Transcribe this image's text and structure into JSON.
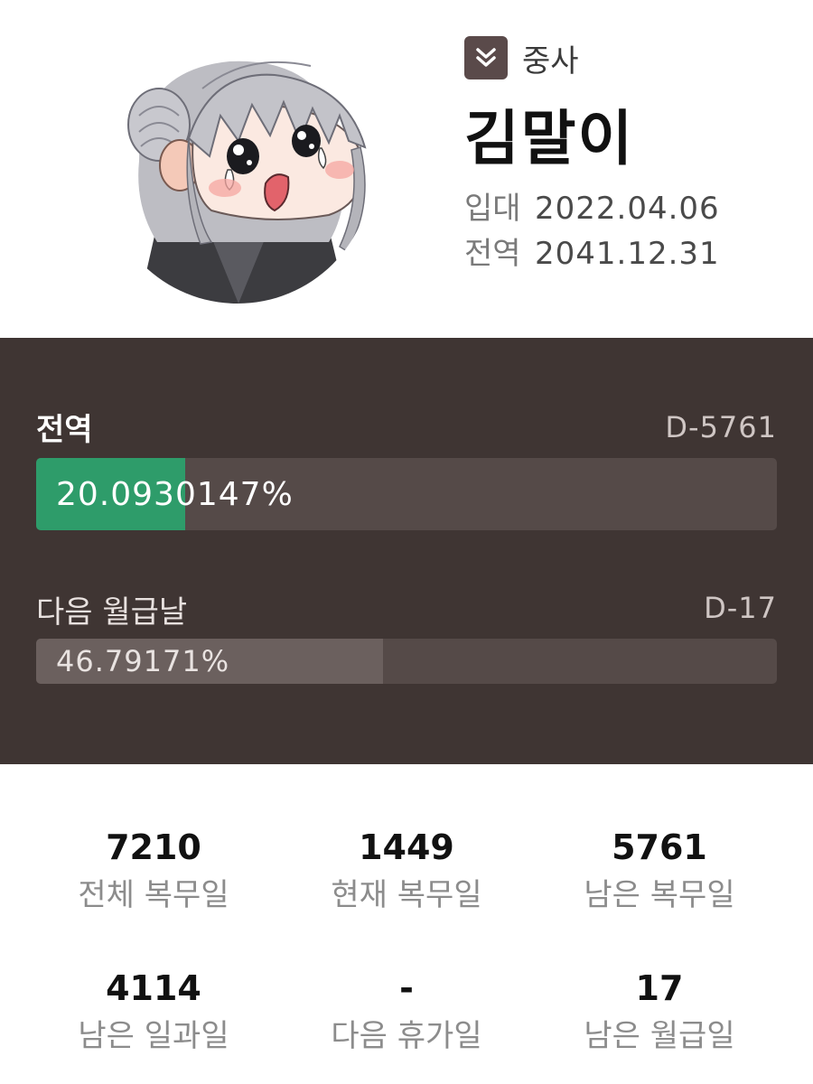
{
  "profile": {
    "rank": "중사",
    "name": "김말이",
    "enlist_label": "입대",
    "enlist_date": "2022.04.06",
    "discharge_label": "전역",
    "discharge_date": "2041.12.31"
  },
  "discharge_progress": {
    "title": "전역",
    "dday": "D-5761",
    "percent_text": "20.0930147%",
    "fraction": 0.200930147
  },
  "payday_progress": {
    "title": "다음 월급날",
    "dday": "D-17",
    "percent_text": "46.79171%",
    "fraction": 0.4679171
  },
  "stats": [
    {
      "value": "7210",
      "label": "전체 복무일"
    },
    {
      "value": "1449",
      "label": "현재 복무일"
    },
    {
      "value": "5761",
      "label": "남은 복무일"
    },
    {
      "value": "4114",
      "label": "남은 일과일"
    },
    {
      "value": "-",
      "label": "다음 휴가일"
    },
    {
      "value": "17",
      "label": "남은 월급일"
    }
  ],
  "colors": {
    "panel": "#3f3533",
    "discharge_fill": "#2e9c6a",
    "payday_fill": "#6b605e",
    "rank_badge": "#5a4a4a"
  }
}
